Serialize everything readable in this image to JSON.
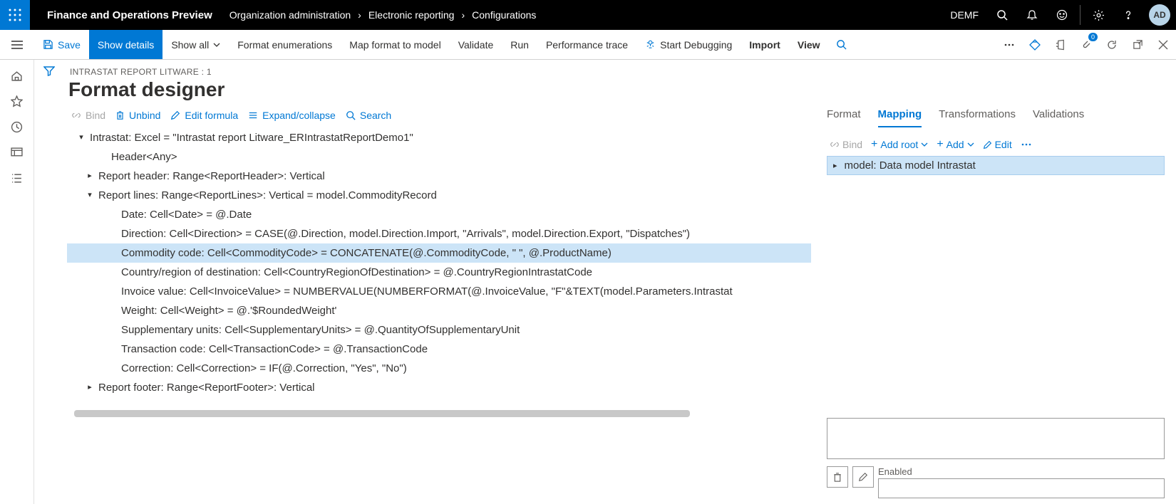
{
  "header": {
    "app_title": "Finance and Operations Preview",
    "breadcrumb": [
      "Organization administration",
      "Electronic reporting",
      "Configurations"
    ],
    "company": "DEMF",
    "avatar": "AD"
  },
  "commandbar": {
    "save": "Save",
    "show_details": "Show details",
    "show_all": "Show all",
    "format_enum": "Format enumerations",
    "map_format": "Map format to model",
    "validate": "Validate",
    "run": "Run",
    "perf": "Performance trace",
    "start_debug": "Start Debugging",
    "import": "Import",
    "view": "View",
    "badge": "0"
  },
  "page": {
    "breadcrumb2": "INTRASTAT REPORT LITWARE : 1",
    "title": "Format designer"
  },
  "toolbar_left": {
    "bind": "Bind",
    "unbind": "Unbind",
    "edit_formula": "Edit formula",
    "expand": "Expand/collapse",
    "search": "Search"
  },
  "tree": {
    "root": "Intrastat: Excel = \"Intrastat report Litware_ERIntrastatReportDemo1\"",
    "header_any": "Header<Any>",
    "report_header": "Report header: Range<ReportHeader>: Vertical",
    "report_lines": "Report lines: Range<ReportLines>: Vertical = model.CommodityRecord",
    "date": "Date: Cell<Date> = @.Date",
    "direction": "Direction: Cell<Direction> = CASE(@.Direction, model.Direction.Import, \"Arrivals\", model.Direction.Export, \"Dispatches\")",
    "commodity": "Commodity code: Cell<CommodityCode> = CONCATENATE(@.CommodityCode, \" \", @.ProductName)",
    "country": "Country/region of destination: Cell<CountryRegionOfDestination> = @.CountryRegionIntrastatCode",
    "invoice": "Invoice value: Cell<InvoiceValue> = NUMBERVALUE(NUMBERFORMAT(@.InvoiceValue, \"F\"&TEXT(model.Parameters.Intrastat",
    "weight": "Weight: Cell<Weight> = @.'$RoundedWeight'",
    "supp": "Supplementary units: Cell<SupplementaryUnits> = @.QuantityOfSupplementaryUnit",
    "trans": "Transaction code: Cell<TransactionCode> = @.TransactionCode",
    "correction": "Correction: Cell<Correction> = IF(@.Correction, \"Yes\", \"No\")",
    "footer": "Report footer: Range<ReportFooter>: Vertical"
  },
  "tabs": {
    "format": "Format",
    "mapping": "Mapping",
    "transformations": "Transformations",
    "validations": "Validations"
  },
  "toolbar_right": {
    "bind": "Bind",
    "add_root": "Add root",
    "add": "Add",
    "edit": "Edit"
  },
  "mapping": {
    "model": "model: Data model Intrastat"
  },
  "bottom": {
    "enabled_label": "Enabled"
  }
}
